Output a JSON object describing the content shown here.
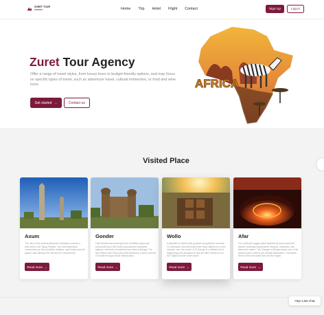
{
  "brand": {
    "name": "ZURET TOUR",
    "sub": "AGENCY"
  },
  "nav": {
    "links": [
      "Home",
      "Trip",
      "Hotel",
      "Flight",
      "Contact"
    ],
    "signup": "Sign Up",
    "login": "Log in"
  },
  "hero": {
    "title_accent": "Zuret",
    "title_rest": " Tour Agency",
    "description": "Offer a range of travel styles, from luxury tours to budget-friendly options, and may focus on specific types of travel, such as adventure travel, cultural immersion, or food and wine tours",
    "start_label": "Get started",
    "contact_label": "Contact us",
    "map_label": "AFRICA"
  },
  "section": {
    "title": "Visited Place"
  },
  "cards": [
    {
      "title": "Axum",
      "text": "The ruins of the ancient Aksumite Civilization covered a wide area in the Tigray Plateau. The most impressive monuments are the monolithic obelisks, royal tombs and the palace ruins dating to the 4th and 7th centuries AD.",
      "button": "Read more"
    },
    {
      "title": "Gonder",
      "text": "Fasil Ghebbi was developed into a fortified compound surrounded by a 900 metre-long wall and contained palaces, churches, monasteries and other buildings. The site reflects both Hindu and Arab influences, a which arrived in Gonder through Jesuit missionaries.",
      "button": "Read more"
    },
    {
      "title": "Wollo",
      "text": "A labyrinth of tunnels with grottoes and galleries connects 11 impressive churches built under King Lalibela out of red volcanic rock, the church of St George is a brilliant feat of engineering and architecture and are often referred to as the \"Eighth wonder of the world\".",
      "button": "Read more"
    },
    {
      "title": "Afar",
      "text": "It is a wild and rugged place featured by below sea-level deserts, towering escarpments, fissures, volcanoes, salt lakes and craters. This Triangle in Ethiopia keeps one of the lowest points in Africa, the Danakil depression. The Awash River is the main water flow into the region.",
      "button": "Read more"
    }
  ],
  "chat": {
    "label": "Hey! Lets chat"
  }
}
